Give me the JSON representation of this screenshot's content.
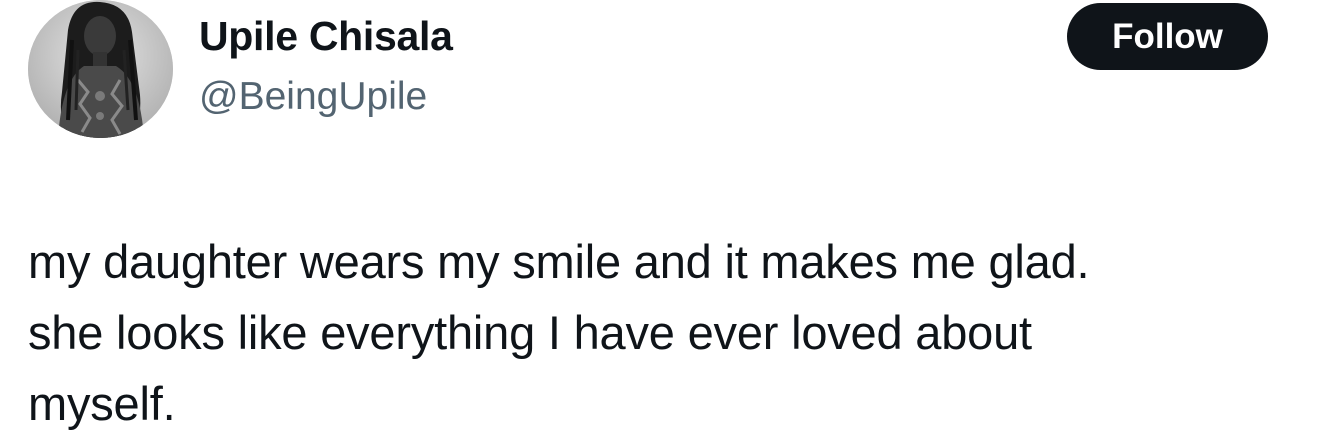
{
  "author": {
    "display_name": "Upile Chisala",
    "handle": "@BeingUpile",
    "avatar_icon": "profile-photo"
  },
  "actions": {
    "follow_label": "Follow"
  },
  "tweet": {
    "lines": [
      "my daughter wears my smile and it makes me glad.",
      "she looks like everything I have ever loved about",
      "myself."
    ]
  },
  "colors": {
    "text": "#0f1419",
    "secondary_text": "#536471",
    "button_bg": "#0f1419",
    "button_text": "#ffffff",
    "background": "#ffffff"
  }
}
